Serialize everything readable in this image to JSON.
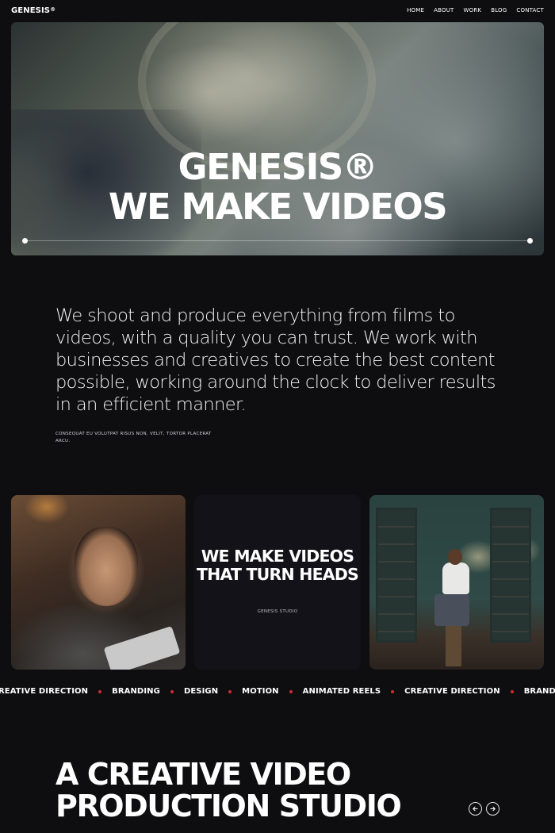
{
  "nav": {
    "logo": "GENESIS",
    "logo_mark": "®",
    "links": [
      "HOME",
      "ABOUT",
      "WORK",
      "BLOG",
      "CONTACT"
    ]
  },
  "hero": {
    "title_line1": "GENESIS®",
    "title_line2": "WE MAKE VIDEOS",
    "progress": 0.0
  },
  "intro": {
    "text": "We shoot and produce everything from films to videos, with a quality you can trust. We work with businesses and creatives to create the best content possible, working around the clock to deliver results in an efficient manner.",
    "note": "CONSEQUAT EU VOLUTPAT RISUS NON, VELIT, TORTOR PLACERAT ARCU."
  },
  "cards": {
    "center_title": "WE MAKE VIDEOS THAT TURN HEADS",
    "center_sub": "GENESIS STUDIO"
  },
  "marquee": {
    "items": [
      "REATIVE DIRECTION",
      "BRANDING",
      "DESIGN",
      "MOTION",
      "ANIMATED REELS",
      "CREATIVE DIRECTION",
      "BRANDING"
    ],
    "dot_color": "#d22a2f"
  },
  "section": {
    "title": "A CREATIVE VIDEO PRODUCTION STUDIO",
    "prev_icon": "arrow-left-icon",
    "next_icon": "arrow-right-icon"
  },
  "colors": {
    "background": "#0e0d10",
    "text": "#f2f1f3",
    "accent": "#d22a2f"
  }
}
